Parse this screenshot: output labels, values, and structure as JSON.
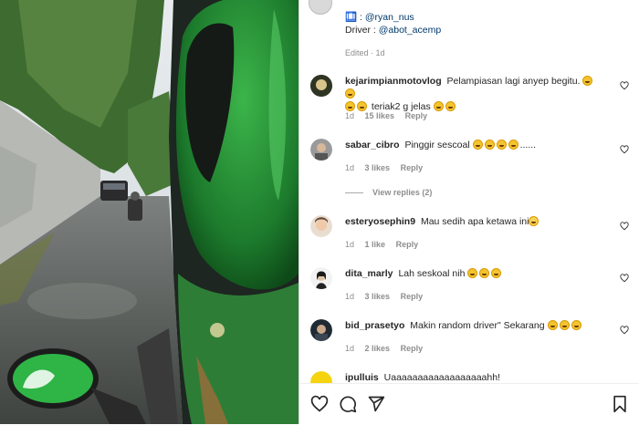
{
  "caption": {
    "line1_prefix": "🛄 : ",
    "line1_mention": "@ryan_nus",
    "line2_prefix": "Driver : ",
    "line2_mention": "@abot_acemp",
    "meta": "Edited · 1d"
  },
  "comments": [
    {
      "user": "kejarimpianmotovlog",
      "text": "Pelampiasan lagi anyep begitu.",
      "text2": "teriak2 g jelas",
      "time": "1d",
      "likes": "15 likes",
      "reply": "Reply"
    },
    {
      "user": "sabar_cibro",
      "text": "Pinggir sescoal",
      "text_tail": "......",
      "time": "1d",
      "likes": "3 likes",
      "reply": "Reply"
    },
    {
      "user": "esteryosephin9",
      "text": "Mau sedih apa ketawa ini",
      "time": "1d",
      "likes": "1 like",
      "reply": "Reply"
    },
    {
      "user": "dita_marly",
      "text": "Lah seskoal nih",
      "time": "1d",
      "likes": "3 likes",
      "reply": "Reply"
    },
    {
      "user": "bid_prasetyo",
      "text": "Makin random driver\" Sekarang",
      "time": "1d",
      "likes": "2 likes",
      "reply": "Reply"
    },
    {
      "user": "ipulluis",
      "text": "Uaaaaaaaaaaaaaaaaaahh!"
    }
  ],
  "view_replies": "View replies (2)",
  "icons": [
    "heart-icon",
    "comment-icon",
    "share-icon",
    "bookmark-icon"
  ]
}
